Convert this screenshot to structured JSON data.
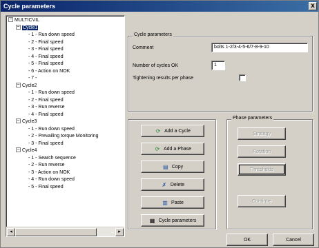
{
  "window": {
    "title": "Cycle parameters",
    "close_glyph": "x"
  },
  "tree": {
    "root": {
      "label": "MULTICVIL",
      "expander": "−"
    },
    "cycles": [
      {
        "label": "Cycle1",
        "selected": true,
        "items": [
          "1 - Run down speed",
          "2 - Final speed",
          "3 - Final speed",
          "4 - Final speed",
          "5 - Final speed",
          "6 - Action on NOK",
          "7 -"
        ]
      },
      {
        "label": "Cycle2",
        "selected": false,
        "items": [
          "1 - Run down speed",
          "2 - Final speed",
          "3 - Run reverse",
          "4 - Final speed"
        ]
      },
      {
        "label": "Cycle3",
        "selected": false,
        "items": [
          "1 - Run down speed",
          "2 - Prevailing torque Monitoring",
          "3 - Final speed"
        ]
      },
      {
        "label": "Cycle4",
        "selected": false,
        "items": [
          "1 - Search sequence",
          "2 - Run reverse",
          "3 - Action on NOK",
          "4 - Run down speed",
          "5 - Final speed"
        ]
      }
    ],
    "scroll_left": "◂",
    "scroll_right": "▸"
  },
  "cycle_params": {
    "group_label": "Cycle parameters",
    "comment_label": "Comment",
    "comment_value": "bolts 1-2/3-4-5-6/7-8-9-10",
    "cycles_ok_label": "Number of cycles OK",
    "cycles_ok_value": "1",
    "tightening_label": "Tightening results per phase"
  },
  "actions": {
    "add_cycle": "Add a Cycle",
    "add_phase": "Add a Phase",
    "copy": "Copy",
    "delete": "Delete",
    "paste": "Paste",
    "cycle_parameters": "Cycle parameters"
  },
  "phase_params": {
    "group_label": "Phase parameters",
    "buttons": [
      "Strategy",
      "Rotation",
      "Thresholds",
      "Continue"
    ]
  },
  "footer": {
    "ok": "OK",
    "cancel": "Cancel"
  },
  "colors": {
    "selection": "#0a246a",
    "titlebar": "#0a246a",
    "face": "#d4d0c8"
  }
}
